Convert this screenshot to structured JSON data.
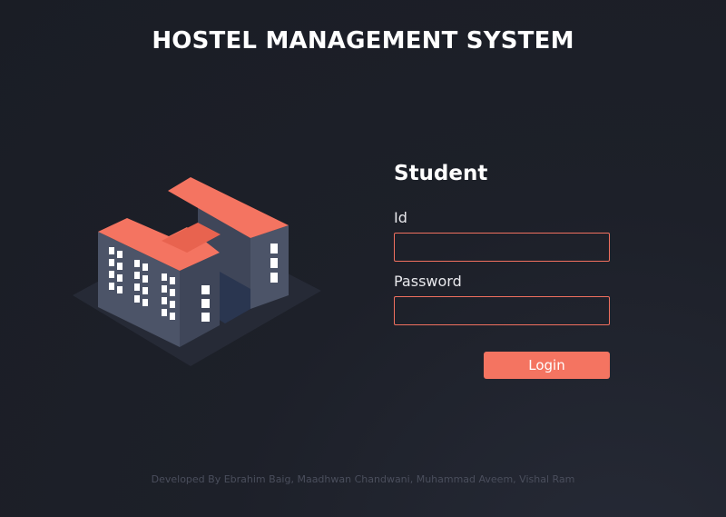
{
  "header": {
    "title": "HOSTEL MANAGEMENT SYSTEM"
  },
  "illustration": {
    "icon": "hostel-building-icon",
    "accent_color": "#f47461",
    "wall_color": "#4c5468"
  },
  "login": {
    "heading": "Student",
    "id_label": "Id",
    "id_value": "",
    "password_label": "Password",
    "password_value": "",
    "button_label": "Login",
    "accent_color": "#f47461"
  },
  "footer": {
    "credit": "Developed By Ebrahim Baig, Maadhwan Chandwani, Muhammad Aveem, Vishal Ram"
  }
}
